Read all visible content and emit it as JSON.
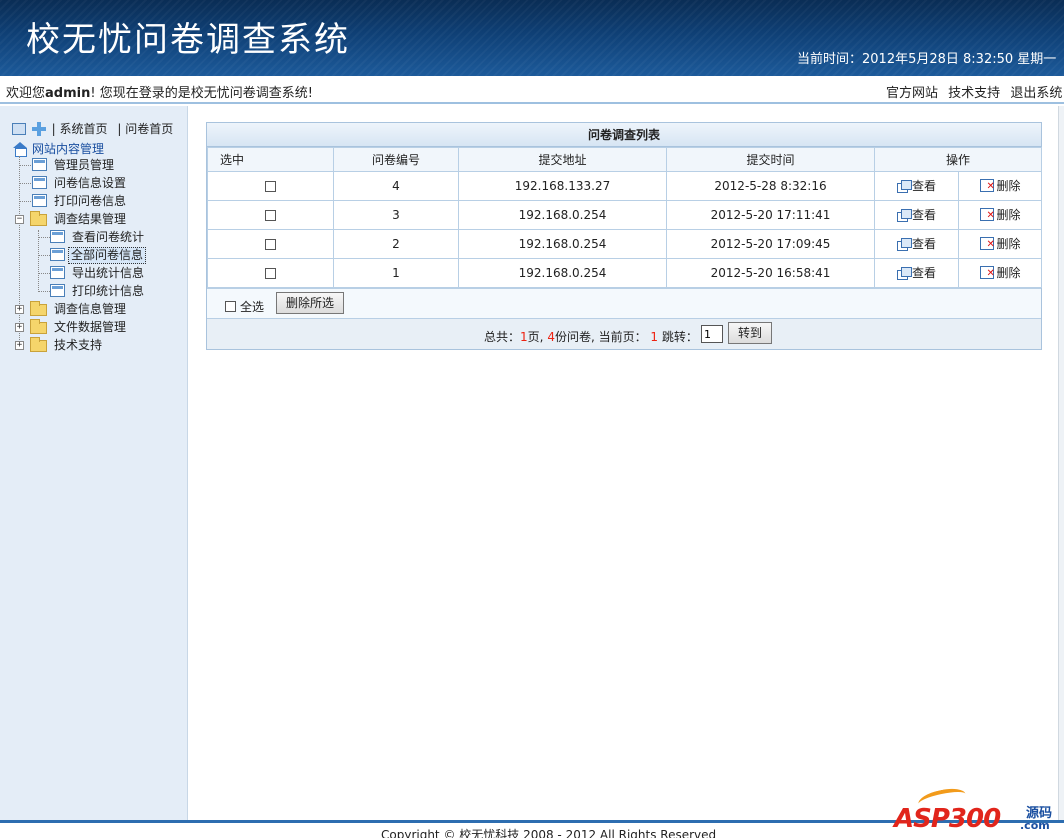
{
  "header": {
    "title": "校无忧问卷调查系统",
    "clock": "当前时间：2012年5月28日  8:32:50 星期一"
  },
  "welcome": {
    "prefix": "欢迎您",
    "user": "admin",
    "suffix": "! 您现在登录的是校无忧问卷调查系统!",
    "links": [
      "官方网站",
      "技术支持",
      "退出系统"
    ]
  },
  "sidebar": {
    "toolbar": {
      "sys_home": "| 系统首页",
      "survey_home": "| 问卷首页"
    },
    "root": "网站内容管理",
    "items": [
      {
        "label": "管理员管理",
        "icon": "page-icon"
      },
      {
        "label": "问卷信息设置",
        "icon": "page-icon"
      },
      {
        "label": "打印问卷信息",
        "icon": "page-icon"
      },
      {
        "label": "调查结果管理",
        "icon": "folder-icon",
        "expanded": true
      },
      {
        "label": "查看问卷统计",
        "icon": "page-icon"
      },
      {
        "label": "全部问卷信息",
        "icon": "page-icon",
        "selected": true
      },
      {
        "label": "导出统计信息",
        "icon": "page-icon"
      },
      {
        "label": "打印统计信息",
        "icon": "page-icon"
      },
      {
        "label": "调查信息管理",
        "icon": "folder-icon",
        "expanded": false
      },
      {
        "label": "文件数据管理",
        "icon": "folder-icon",
        "expanded": false
      },
      {
        "label": "技术支持",
        "icon": "folder-icon",
        "expanded": false
      }
    ]
  },
  "panel": {
    "title": "问卷调查列表",
    "columns": [
      "选中",
      "问卷编号",
      "提交地址",
      "提交时间",
      "操作"
    ],
    "view_label": "查看",
    "delete_label": "删除",
    "rows": [
      {
        "id": "4",
        "ip": "192.168.133.27",
        "time": "2012-5-28 8:32:16"
      },
      {
        "id": "3",
        "ip": "192.168.0.254",
        "time": "2012-5-20 17:11:41"
      },
      {
        "id": "2",
        "ip": "192.168.0.254",
        "time": "2012-5-20 17:09:45"
      },
      {
        "id": "1",
        "ip": "192.168.0.254",
        "time": "2012-5-20 16:58:41"
      }
    ],
    "select_all": "全选",
    "delete_selected": "删除所选",
    "pager": {
      "total_label": "总共：",
      "pages": "1",
      "pages_unit": "页,",
      "count": "4",
      "count_unit": "份问卷, 当前页：",
      "current": "1",
      "jump_label": "跳转：",
      "jump_value": "1",
      "go_button": "转到"
    }
  },
  "footer": {
    "copyright": "Copyright © 校无忧科技  2008 - 2012 All Rights Reserved"
  },
  "watermark": {
    "brand": "ASP300",
    "cn": "源码",
    "domain": ".com"
  },
  "colors": {
    "header_bg": "#0f4076",
    "sidebar_bg": "#e4edf7",
    "accent_red": "#e21"
  }
}
